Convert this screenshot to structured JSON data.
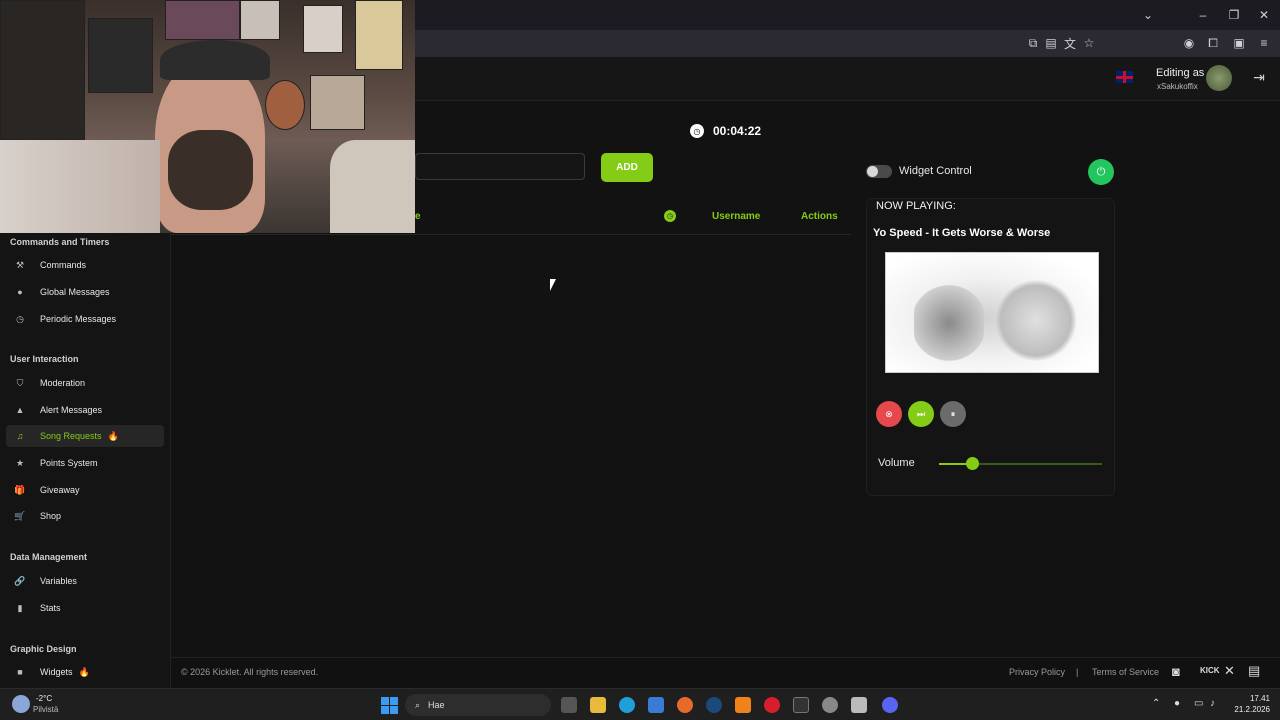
{
  "header": {
    "editing_as": "Editing as",
    "username": "xSakukoffix"
  },
  "timer": {
    "value": "00:04:22"
  },
  "form": {
    "add_label": "ADD",
    "input_value": "",
    "placeholder": ""
  },
  "table": {
    "partial_header": "e",
    "username_header": "Username",
    "actions_header": "Actions"
  },
  "sidebar": {
    "sections": [
      {
        "title": "Commands and Timers"
      },
      {
        "title": "User Interaction"
      },
      {
        "title": "Data Management"
      },
      {
        "title": "Graphic Design"
      }
    ],
    "items": [
      {
        "label": "Commands",
        "icon": "hammer-icon"
      },
      {
        "label": "Global Messages",
        "icon": "chat-bubble-icon"
      },
      {
        "label": "Periodic Messages",
        "icon": "clock-icon"
      },
      {
        "label": "Moderation",
        "icon": "shield-icon"
      },
      {
        "label": "Alert Messages",
        "icon": "warning-triangle-icon"
      },
      {
        "label": "Song Requests",
        "icon": "music-note-icon",
        "active": true,
        "badge": "fire-icon"
      },
      {
        "label": "Points System",
        "icon": "star-icon"
      },
      {
        "label": "Giveaway",
        "icon": "gift-icon"
      },
      {
        "label": "Shop",
        "icon": "cart-icon"
      },
      {
        "label": "Variables",
        "icon": "link-icon"
      },
      {
        "label": "Stats",
        "icon": "bar-chart-icon"
      },
      {
        "label": "Widgets",
        "icon": "video-icon",
        "badge": "fire-icon"
      }
    ]
  },
  "player": {
    "widget_control_label": "Widget Control",
    "widget_control_on": false,
    "now_playing_label": "NOW PLAYING:",
    "track_title": "Yo Speed - It Gets Worse & Worse",
    "volume_label": "Volume",
    "volume_level": 0.2
  },
  "footer": {
    "copyright": "© 2026 Kicklet. All rights reserved.",
    "privacy": "Privacy Policy",
    "separator": "|",
    "terms": "Terms of Service"
  },
  "taskbar": {
    "weather_temp": "-2°C",
    "weather_desc": "Pilvistä",
    "search_text": "Hae",
    "time": "17.41",
    "date": "21.2.2026"
  },
  "colors": {
    "accent": "#84cc16",
    "stop": "#e5484d",
    "pause": "#6b6b6b",
    "power": "#22c55e"
  }
}
